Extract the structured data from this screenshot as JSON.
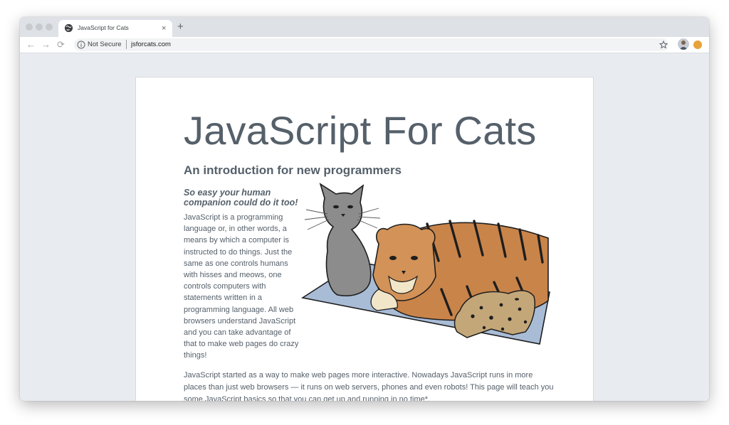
{
  "browser": {
    "tab": {
      "title": "JavaScript for Cats",
      "close_glyph": "×"
    },
    "new_tab_glyph": "+",
    "nav": {
      "back_glyph": "←",
      "forward_glyph": "→",
      "reload_glyph": "⟳"
    },
    "address_bar": {
      "security_label": "Not Secure",
      "url": "jsforcats.com"
    },
    "icons": [
      "globe-icon",
      "info-icon",
      "star-icon",
      "profile-avatar",
      "extension-icon"
    ]
  },
  "page": {
    "title": "JavaScript For Cats",
    "subtitle": "An introduction for new programmers",
    "tagline": "So easy your human companion could do it too!",
    "intro": "JavaScript is a programming language or, in other words, a means by which a computer is instructed to do things. Just the same as one controls humans with hisses and meows, one controls computers with statements written in a programming language. All web browsers understand JavaScript and you can take advantage of that to make web pages do crazy things!",
    "paragraph": "JavaScript started as a way to make web pages more interactive. Nowadays JavaScript runs in more places than just web browsers — it runs on web servers, phones and even robots! This page will teach you some JavaScript basics so that you can get up and running in no time*."
  },
  "colors": {
    "text": "#55606a",
    "page_background": "#e8ecf1",
    "blanket": "#a9bcd6",
    "tiger": "#c9844a",
    "grey_cat": "#8c8c8c",
    "ocelot": "#c4a779"
  }
}
